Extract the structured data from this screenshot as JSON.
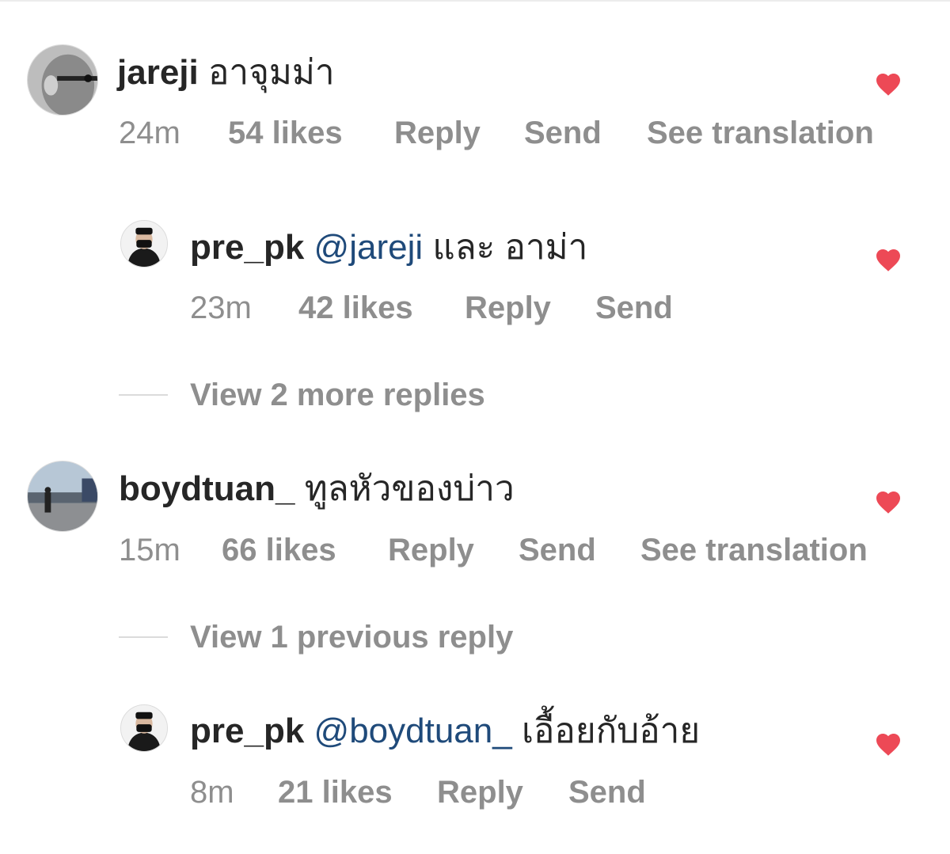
{
  "colors": {
    "heart": "#ed4956",
    "meta": "#8e8e8e",
    "mention": "#1f4a7a",
    "text": "#262626"
  },
  "comments": [
    {
      "username": "jareji",
      "text": "อาจุมม่า",
      "time": "24m",
      "likes": "54 likes",
      "reply": "Reply",
      "send": "Send",
      "translate": "See translation",
      "liked_icon": "heart-filled-icon",
      "replies": [
        {
          "username": "pre_pk",
          "mention": "@jareji",
          "text": "และ อาม่า",
          "time": "23m",
          "likes": "42 likes",
          "reply": "Reply",
          "send": "Send",
          "liked_icon": "heart-filled-icon"
        }
      ],
      "view_replies": "View 2 more replies"
    },
    {
      "username": "boydtuan_",
      "text": "ทูลหัวของบ่าว",
      "time": "15m",
      "likes": "66 likes",
      "reply": "Reply",
      "send": "Send",
      "translate": "See translation",
      "liked_icon": "heart-filled-icon",
      "view_replies": "View 1 previous reply",
      "replies": [
        {
          "username": "pre_pk",
          "mention": "@boydtuan_",
          "text": "เอื้อยกับอ้าย",
          "time": "8m",
          "likes": "21 likes",
          "reply": "Reply",
          "send": "Send",
          "liked_icon": "heart-filled-icon"
        }
      ]
    }
  ]
}
